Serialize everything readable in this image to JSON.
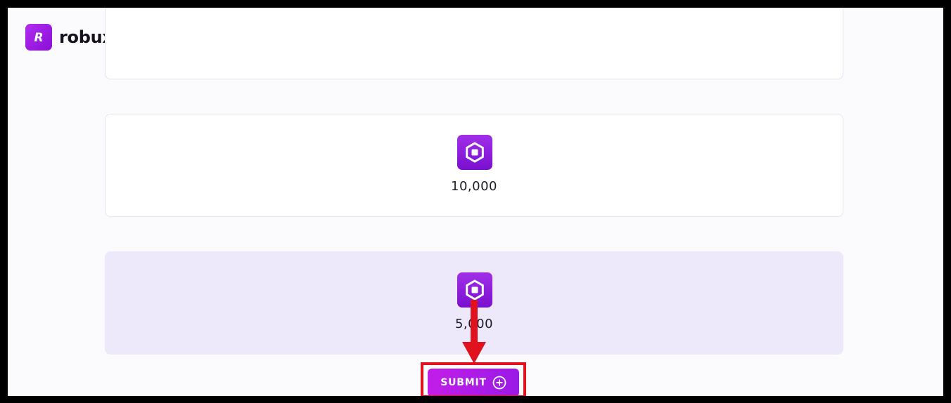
{
  "brand": {
    "name": "robuxify",
    "logo_letter": "R"
  },
  "options": [
    {
      "amount": "10,000",
      "icon": "robux-icon",
      "selected": false
    },
    {
      "amount": "5,000",
      "icon": "robux-icon",
      "selected": true
    }
  ],
  "submit": {
    "label": "SUBMIT",
    "icon": "plus-circle-icon"
  },
  "annotation": {
    "color": "#e0121d"
  },
  "colors": {
    "accent": "#a21ce8",
    "selected_bg": "#ede9fb"
  }
}
